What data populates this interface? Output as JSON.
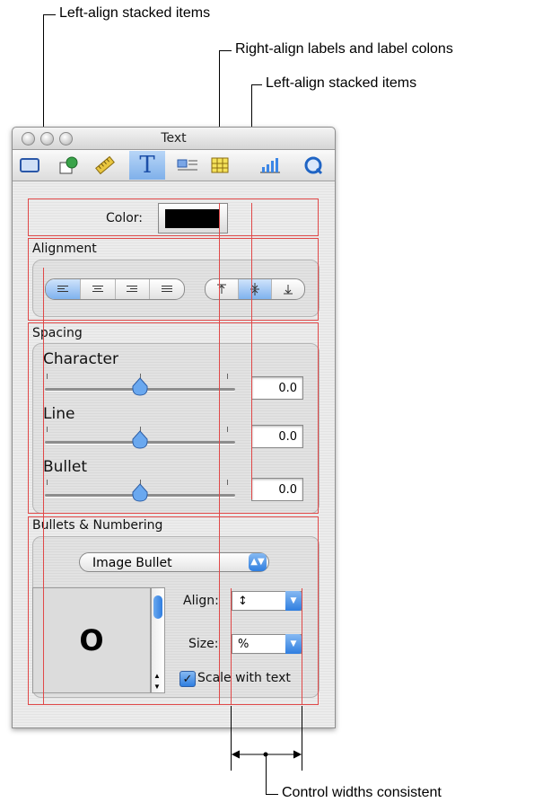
{
  "annotations": {
    "top_left": "Left-align stacked items",
    "right_labels": "Right-align labels and label colons",
    "mid_left": "Left-align stacked items",
    "bottom": "Control widths consistent"
  },
  "window": {
    "title": "Text",
    "toolbar": [
      "document-icon",
      "graphic-icon",
      "metrics-icon",
      "text-icon",
      "wrap-icon",
      "table-icon",
      "chart-icon",
      "quicktime-icon"
    ],
    "selected_tool": "text-icon"
  },
  "color_row": {
    "label": "Color:",
    "swatch": "#000000"
  },
  "alignment": {
    "title": "Alignment",
    "horizontal": [
      "align-left",
      "align-center",
      "align-right",
      "align-justify"
    ],
    "horizontal_selected": "align-left",
    "vertical": [
      "align-top",
      "align-middle",
      "align-bottom"
    ],
    "vertical_selected": "align-middle"
  },
  "spacing": {
    "title": "Spacing",
    "rows": [
      {
        "label": "Character",
        "value": "0.0",
        "level": 0.5
      },
      {
        "label": "Line",
        "value": "0.0",
        "level": 0.5
      },
      {
        "label": "Bullet",
        "value": "0.0",
        "level": 0.5
      }
    ]
  },
  "bullets": {
    "title": "Bullets & Numbering",
    "popup": "Image Bullet",
    "preview_glyph": "O",
    "align_label": "Align:",
    "align_value": "↕",
    "size_label": "Size:",
    "size_value": "%",
    "scale_label": "Scale with text",
    "scale_checked": true
  },
  "colors": {
    "guide": "#e04848",
    "accent": "#3b86e6"
  }
}
